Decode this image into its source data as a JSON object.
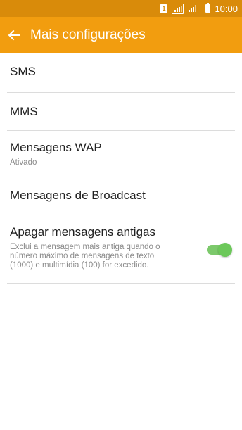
{
  "status_bar": {
    "sim_label": "1",
    "time": "10:00"
  },
  "app_bar": {
    "title": "Mais configurações",
    "back_icon": "arrow-left-icon"
  },
  "settings": {
    "items": [
      {
        "title": "SMS"
      },
      {
        "title": "MMS"
      },
      {
        "title": "Mensagens WAP",
        "subtitle": "Ativado"
      },
      {
        "title": "Mensagens de Broadcast"
      },
      {
        "title": "Apagar mensagens antigas",
        "subtitle_lines": [
          "Exclui a mensagem mais antiga quando o",
          "número máximo de mensagens de texto",
          "(1000) e multimídia (100) for excedido."
        ],
        "toggle_on": true
      }
    ]
  },
  "colors": {
    "status_bar": "#d98b0a",
    "app_bar": "#f29d0f",
    "toggle_on": "#6cc85a"
  }
}
